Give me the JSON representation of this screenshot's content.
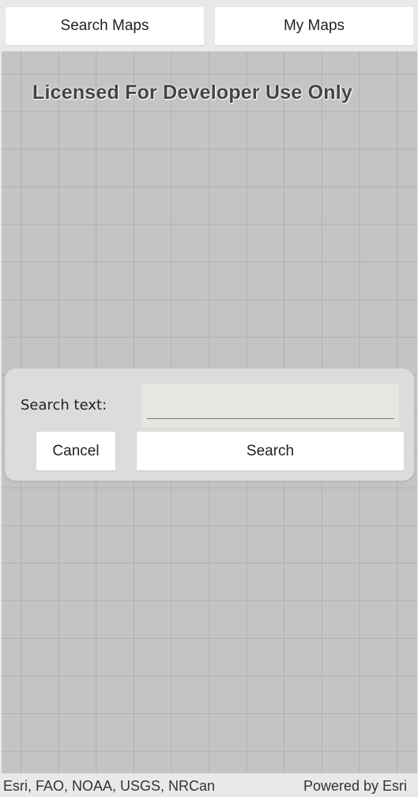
{
  "toolbar": {
    "search_maps_label": "Search Maps",
    "my_maps_label": "My Maps"
  },
  "map": {
    "watermark": "Licensed For Developer Use Only"
  },
  "search_dialog": {
    "label": "Search text:",
    "input_value": "",
    "input_placeholder": "",
    "cancel_label": "Cancel",
    "search_label": "Search"
  },
  "attribution": {
    "sources": "Esri, FAO, NOAA, USGS, NRCan",
    "powered_by": "Powered by Esri"
  },
  "colors": {
    "map_background": "#c4c4c4",
    "toolbar_background": "#e9e9e9",
    "dialog_background": "#dcdcdc",
    "button_background": "#ffffff"
  }
}
